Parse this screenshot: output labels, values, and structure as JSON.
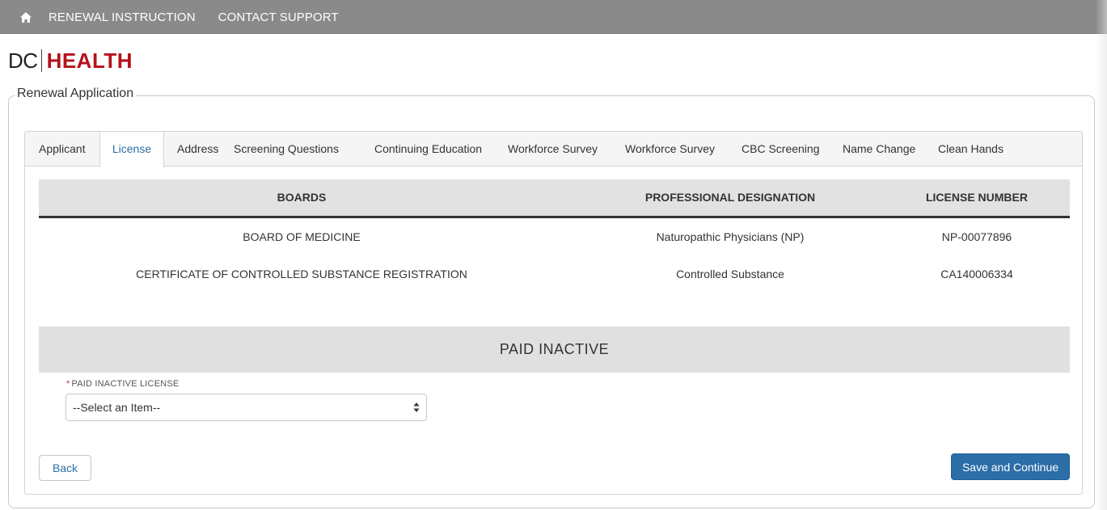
{
  "nav": {
    "home_icon": "home-icon",
    "links": [
      "RENEWAL INSTRUCTION",
      "CONTACT SUPPORT"
    ]
  },
  "logo": {
    "dc": "DC",
    "health": "HEALTH",
    "brand_color": "#b5121b"
  },
  "form": {
    "legend": "Renewal Application"
  },
  "tabs": [
    {
      "label": "Applicant",
      "active": false
    },
    {
      "label": "License",
      "active": true
    },
    {
      "label": "Address",
      "active": false
    },
    {
      "label": "Screening Questions",
      "active": false
    },
    {
      "label": "Continuing Education",
      "active": false
    },
    {
      "label": "Workforce Survey",
      "active": false
    },
    {
      "label": "Workforce Survey",
      "active": false
    },
    {
      "label": "CBC Screening",
      "active": false
    },
    {
      "label": "Name Change",
      "active": false
    },
    {
      "label": "Clean Hands",
      "active": false
    }
  ],
  "license_table": {
    "columns": [
      "BOARDS",
      "PROFESSIONAL DESIGNATION",
      "LICENSE NUMBER"
    ],
    "rows": [
      [
        "BOARD OF MEDICINE",
        "Naturopathic Physicians (NP)",
        "NP-00077896"
      ],
      [
        "CERTIFICATE OF CONTROLLED SUBSTANCE REGISTRATION",
        "Controlled Substance",
        "CA140006334"
      ]
    ]
  },
  "paid_inactive": {
    "section_title": "PAID INACTIVE",
    "required_marker": "*",
    "field_label": "PAID INACTIVE LICENSE",
    "selected_value": "--Select an Item--"
  },
  "actions": {
    "back_label": "Back",
    "save_label": "Save and Continue",
    "primary_color": "#2b6ea8",
    "link_color": "#2a6fa8"
  }
}
